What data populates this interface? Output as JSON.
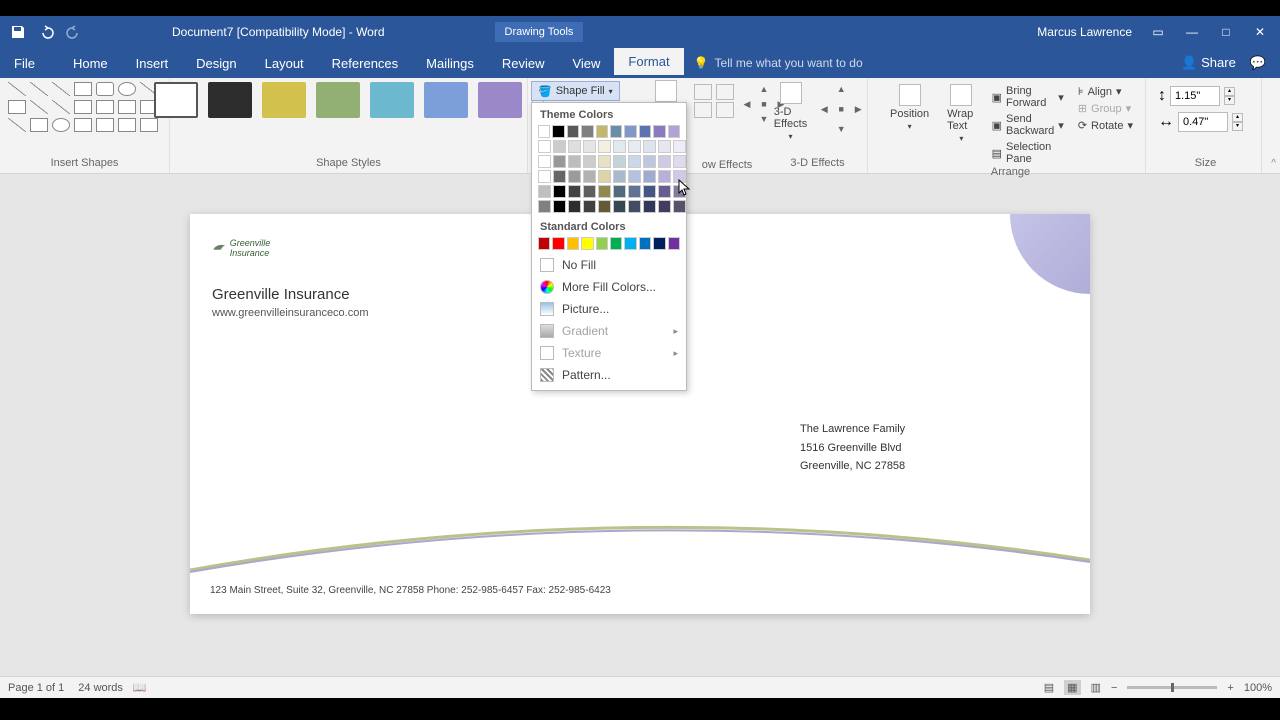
{
  "title": "Document7 [Compatibility Mode] - Word",
  "context_tab": "Drawing Tools",
  "user": "Marcus Lawrence",
  "tabs": [
    "File",
    "Home",
    "Insert",
    "Design",
    "Layout",
    "References",
    "Mailings",
    "Review",
    "View",
    "Format"
  ],
  "tell_me": "Tell me what you want to do",
  "share_label": "Share",
  "ribbon": {
    "insert_shapes": "Insert Shapes",
    "shape_styles": "Shape Styles",
    "shadow_effects": "Shadow Effects",
    "threeD": "3-D Effects",
    "threeD_btn": "3-D Effects",
    "arrange": "Arrange",
    "size": "Size",
    "shape_fill": "Shape Fill",
    "position": "Position",
    "wrap": "Wrap Text",
    "bring_forward": "Bring Forward",
    "send_backward": "Send Backward",
    "selection_pane": "Selection Pane",
    "align": "Align",
    "group": "Group",
    "rotate": "Rotate",
    "height": "1.15\"",
    "width": "0.47\"",
    "style_colors": [
      "#2d2d2d",
      "#d2c24d",
      "#92b073",
      "#6cb9cf",
      "#7c9fd9",
      "#9a88c9"
    ]
  },
  "fill_menu": {
    "theme_label": "Theme Colors",
    "standard_label": "Standard Colors",
    "theme_row": [
      "#ffffff",
      "#000000",
      "#595959",
      "#7f7f7f",
      "#c4b66b",
      "#6b8ea8",
      "#8099c9",
      "#5b74b0",
      "#8a7ac0",
      "#b2a2d6"
    ],
    "standard_row": [
      "#c00000",
      "#ff0000",
      "#ffc000",
      "#ffff00",
      "#92d050",
      "#00b050",
      "#00b0f0",
      "#0070c0",
      "#002060",
      "#7030a0"
    ],
    "no_fill": "No Fill",
    "more_colors": "More Fill Colors...",
    "picture": "Picture...",
    "gradient": "Gradient",
    "texture": "Texture",
    "pattern": "Pattern..."
  },
  "document": {
    "logo_text": "Greenville Insurance",
    "company": "Greenville Insurance",
    "url": "www.greenvilleinsuranceco.com",
    "addr1": "The Lawrence Family",
    "addr2": "1516 Greenville Blvd",
    "addr3": "Greenville, NC 27858",
    "footer": "123 Main Street, Suite 32, Greenville, NC 27858 Phone: 252-985-6457 Fax: 252-985-6423"
  },
  "status": {
    "page": "Page 1 of 1",
    "words": "24 words",
    "zoom": "100%"
  }
}
